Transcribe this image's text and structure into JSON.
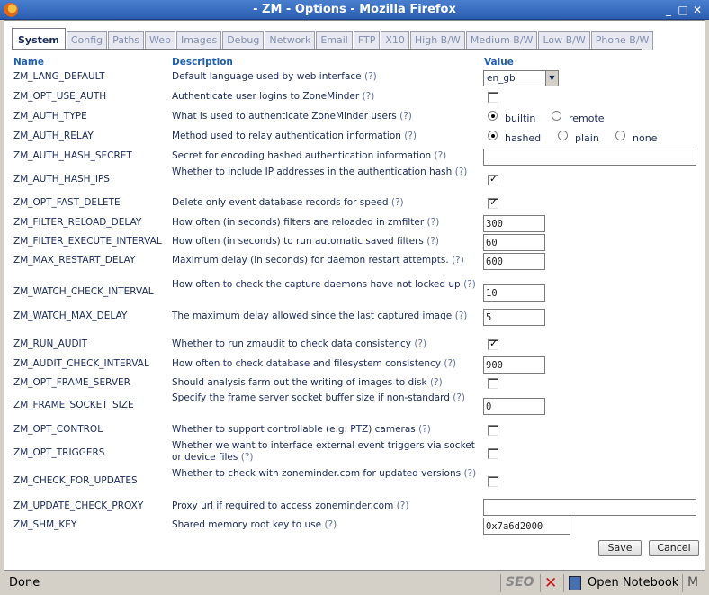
{
  "window": {
    "title": "- ZM - Options - Mozilla Firefox",
    "minimize": "_",
    "maximize": "□",
    "close": "✕"
  },
  "tabs": [
    "System",
    "Config",
    "Paths",
    "Web",
    "Images",
    "Debug",
    "Network",
    "Email",
    "FTP",
    "X10",
    "High B/W",
    "Medium B/W",
    "Low B/W",
    "Phone B/W"
  ],
  "active_tab": "System",
  "headers": {
    "name": "Name",
    "description": "Description",
    "value": "Value"
  },
  "help_marker": "(?)",
  "options": [
    {
      "name": "ZM_LANG_DEFAULT",
      "desc": "Default language used by web interface",
      "type": "select",
      "value": "en_gb"
    },
    {
      "name": "ZM_OPT_USE_AUTH",
      "desc": "Authenticate user logins to ZoneMinder",
      "type": "checkbox",
      "checked": false
    },
    {
      "name": "ZM_AUTH_TYPE",
      "desc": "What is used to authenticate ZoneMinder users",
      "type": "radio",
      "options": [
        "builtin",
        "remote"
      ],
      "selected": "builtin"
    },
    {
      "name": "ZM_AUTH_RELAY",
      "desc": "Method used to relay authentication information",
      "type": "radio",
      "options": [
        "hashed",
        "plain",
        "none"
      ],
      "selected": "hashed"
    },
    {
      "name": "ZM_AUTH_HASH_SECRET",
      "desc": "Secret for encoding hashed authentication information",
      "type": "text",
      "value": "",
      "wide": true
    },
    {
      "name": "ZM_AUTH_HASH_IPS",
      "desc": "Whether to include IP addresses in the authentication hash",
      "type": "checkbox",
      "checked": true
    },
    {
      "name": "ZM_OPT_FAST_DELETE",
      "desc": "Delete only event database records for speed",
      "type": "checkbox",
      "checked": true
    },
    {
      "name": "ZM_FILTER_RELOAD_DELAY",
      "desc": "How often (in seconds) filters are reloaded in zmfilter",
      "type": "text",
      "value": "300"
    },
    {
      "name": "ZM_FILTER_EXECUTE_INTERVAL",
      "desc": "How often (in seconds) to run automatic saved filters",
      "type": "text",
      "value": "60"
    },
    {
      "name": "ZM_MAX_RESTART_DELAY",
      "desc": "Maximum delay (in seconds) for daemon restart attempts.",
      "type": "text",
      "value": "600"
    },
    {
      "name": "ZM_WATCH_CHECK_INTERVAL",
      "desc": "How often to check the capture daemons have not locked up",
      "type": "text",
      "value": "10"
    },
    {
      "name": "ZM_WATCH_MAX_DELAY",
      "desc": "The maximum delay allowed since the last captured image",
      "type": "text",
      "value": "5"
    },
    {
      "name": "ZM_RUN_AUDIT",
      "desc": "Whether to run zmaudit to check data consistency",
      "type": "checkbox",
      "checked": true
    },
    {
      "name": "ZM_AUDIT_CHECK_INTERVAL",
      "desc": "How often to check database and filesystem consistency",
      "type": "text",
      "value": "900"
    },
    {
      "name": "ZM_OPT_FRAME_SERVER",
      "desc": "Should analysis farm out the writing of images to disk",
      "type": "checkbox",
      "checked": false
    },
    {
      "name": "ZM_FRAME_SOCKET_SIZE",
      "desc": "Specify the frame server socket buffer size if non-standard",
      "type": "text",
      "value": "0"
    },
    {
      "name": "ZM_OPT_CONTROL",
      "desc": "Whether to support controllable (e.g. PTZ) cameras",
      "type": "checkbox",
      "checked": false
    },
    {
      "name": "ZM_OPT_TRIGGERS",
      "desc": "Whether we want to interface external event triggers via socket or device files",
      "type": "checkbox",
      "checked": false
    },
    {
      "name": "ZM_CHECK_FOR_UPDATES",
      "desc": "Whether to check with zoneminder.com for updated versions",
      "type": "checkbox",
      "checked": false
    },
    {
      "name": "ZM_UPDATE_CHECK_PROXY",
      "desc": "Proxy url if required to access zoneminder.com",
      "type": "text",
      "value": "",
      "wide": true
    },
    {
      "name": "ZM_SHM_KEY",
      "desc": "Shared memory root key to use",
      "type": "text",
      "value": "0x7a6d2000",
      "medium": true
    }
  ],
  "buttons": {
    "save": "Save",
    "cancel": "Cancel"
  },
  "statusbar": {
    "status": "Done",
    "seo": "SEO",
    "notebook": "Open Notebook",
    "mail": "M"
  }
}
